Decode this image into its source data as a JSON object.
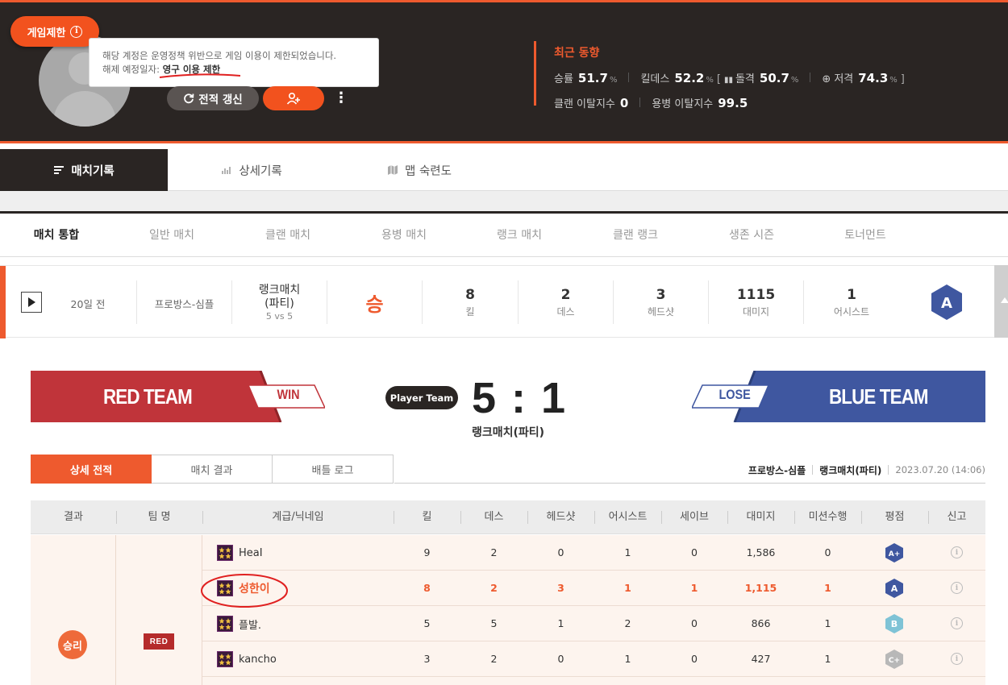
{
  "header": {
    "restrict_label": "게임제한",
    "tooltip_line1": "해당 계정은 운영정책 위반으로 게임 이용이 제한되었습니다.",
    "tooltip_line2_prefix": "해제 예정일자: ",
    "tooltip_line2_value": "영구 이용 제한",
    "refresh_label": "전적 갱신",
    "stats": {
      "title": "최근 동향",
      "win_rate_label": "승률",
      "win_rate": "51.7",
      "kd_label": "킬데스",
      "kd": "52.2",
      "assault_label": "돌격",
      "assault": "50.7",
      "sniper_label": "저격",
      "sniper": "74.3",
      "percent": "%",
      "clan_leave_label": "클랜 이탈지수",
      "clan_leave": "0",
      "merc_leave_label": "용병 이탈지수",
      "merc_leave": "99.5"
    }
  },
  "tabs": [
    {
      "label": "매치기록",
      "icon": "list-icon"
    },
    {
      "label": "상세기록",
      "icon": "bar-chart-icon"
    },
    {
      "label": "맵 숙련도",
      "icon": "map-icon"
    }
  ],
  "filters": [
    "매치 통합",
    "일반 매치",
    "클랜 매치",
    "용병 매치",
    "랭크 매치",
    "클랜 랭크",
    "생존 시즌",
    "토너먼트"
  ],
  "match": {
    "ago": "20일 전",
    "map": "프로방스-심플",
    "type_line1": "랭크매치",
    "type_line2": "(파티)",
    "format": "5 vs 5",
    "result": "승",
    "kills": "8",
    "kills_label": "킬",
    "deaths": "2",
    "deaths_label": "데스",
    "headshots": "3",
    "headshots_label": "헤드샷",
    "damage": "1115",
    "damage_label": "대미지",
    "assists": "1",
    "assists_label": "어시스트",
    "grade": "A"
  },
  "scoreboard": {
    "red_name": "RED TEAM",
    "red_result": "WIN",
    "blue_name": "BLUE TEAM",
    "blue_result": "LOSE",
    "player_team": "Player Team",
    "score": "5 : 1",
    "match_type": "랭크매치(파티)"
  },
  "subtabs": [
    "상세 전적",
    "매치 결과",
    "배틀 로그"
  ],
  "meta": {
    "map": "프로방스-심플",
    "type": "랭크매치(파티)",
    "date": "2023.07.20 (14:06)"
  },
  "table": {
    "headers": [
      "결과",
      "팀 명",
      "계급/닉네임",
      "킬",
      "데스",
      "헤드샷",
      "어시스트",
      "세이브",
      "대미지",
      "미션수행",
      "평점",
      "신고"
    ],
    "result_label": "승리",
    "team_label": "RED",
    "rows": [
      {
        "nick": "HeaI",
        "kills": "9",
        "deaths": "2",
        "hs": "0",
        "assists": "1",
        "saves": "0",
        "damage": "1,586",
        "mission": "0",
        "grade": "A+"
      },
      {
        "nick": "성한이",
        "kills": "8",
        "deaths": "2",
        "hs": "3",
        "assists": "1",
        "saves": "1",
        "damage": "1,115",
        "mission": "1",
        "grade": "A"
      },
      {
        "nick": "플발.",
        "kills": "5",
        "deaths": "5",
        "hs": "1",
        "assists": "2",
        "saves": "0",
        "damage": "866",
        "mission": "1",
        "grade": "B"
      },
      {
        "nick": "kancho",
        "kills": "3",
        "deaths": "2",
        "hs": "0",
        "assists": "1",
        "saves": "0",
        "damage": "427",
        "mission": "1",
        "grade": "C+"
      }
    ]
  },
  "colors": {
    "accent": "#ee5a2e",
    "dark": "#2a2523",
    "red_team": "#c0343a",
    "blue_team": "#3f57a0",
    "grade_a": "#3f57a0",
    "grade_b": "#7fc3d6",
    "grade_c": "#b8b8b8"
  }
}
